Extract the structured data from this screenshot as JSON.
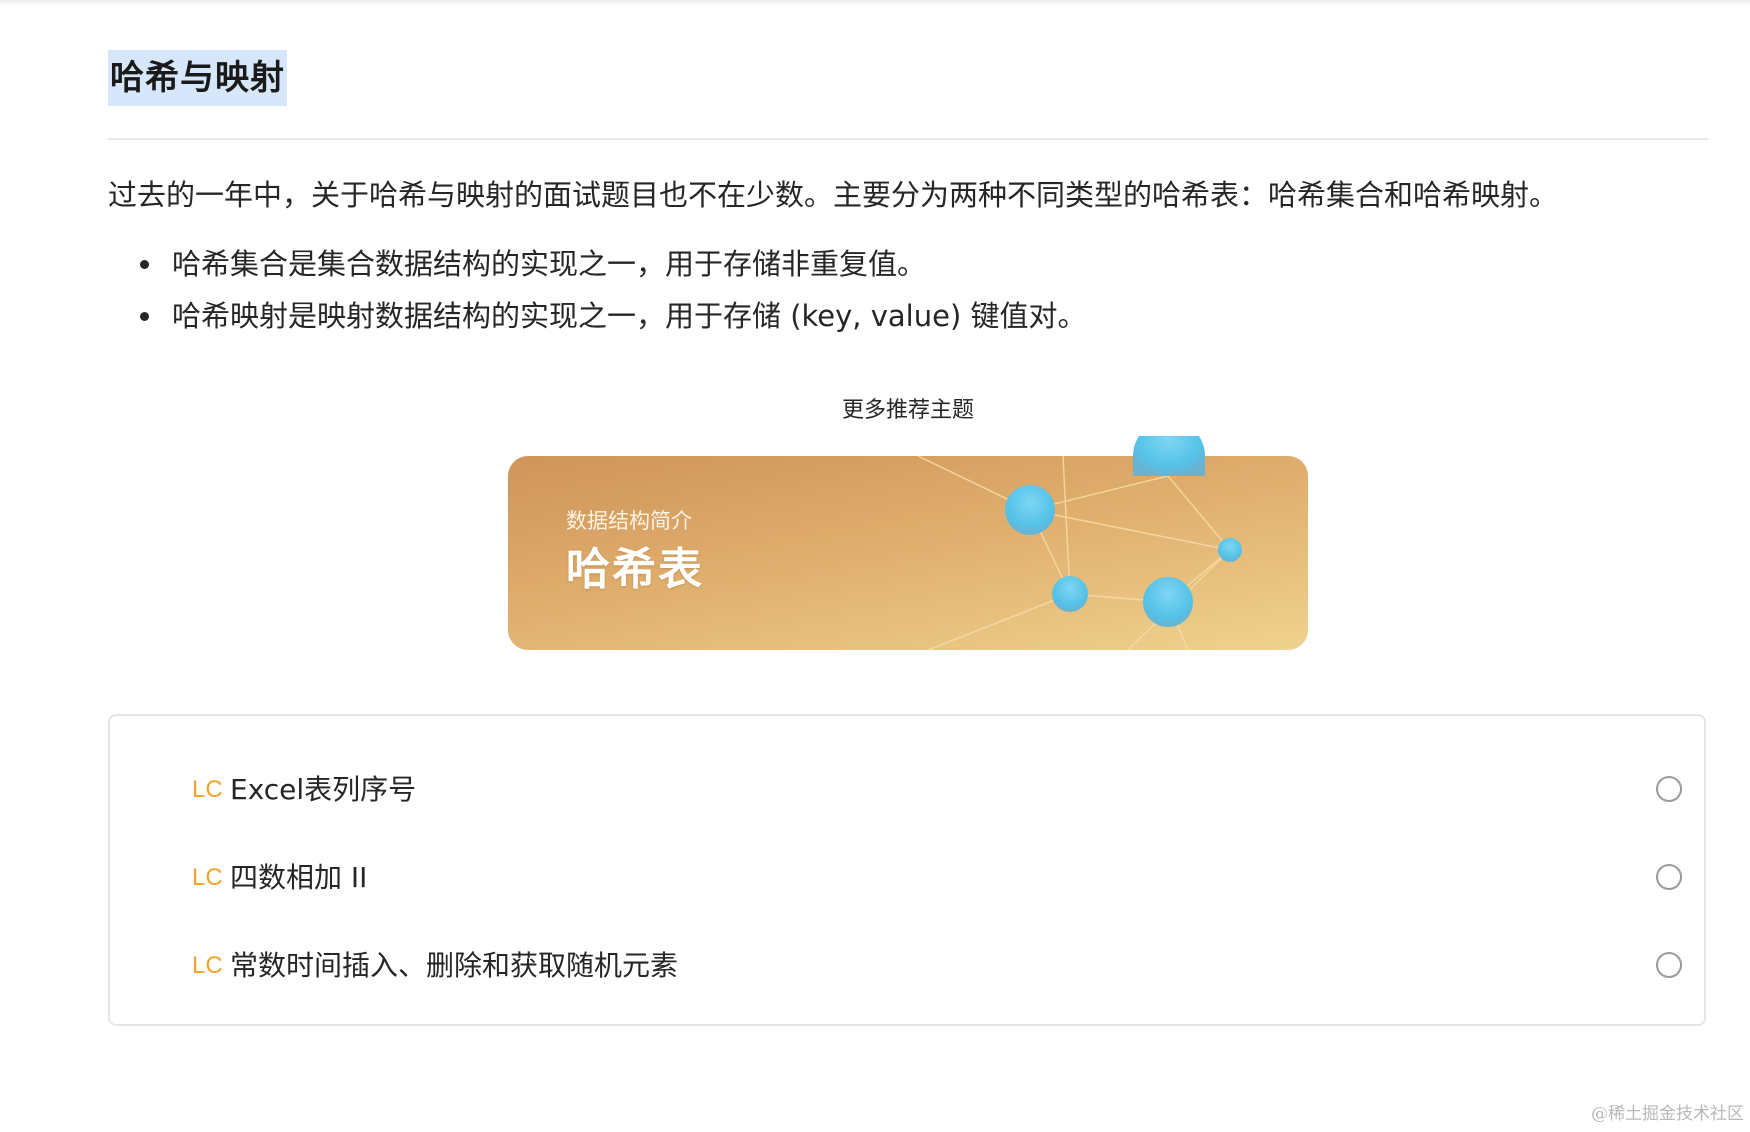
{
  "heading": "哈希与映射",
  "intro": "过去的一年中，关于哈希与映射的面试题目也不在少数。主要分为两种不同类型的哈希表：哈希集合和哈希映射。",
  "bullets": [
    "哈希集合是集合数据结构的实现之一，用于存储非重复值。",
    "哈希映射是映射数据结构的实现之一，用于存储 (key, value) 键值对。"
  ],
  "more_topics_label": "更多推荐主题",
  "banner": {
    "subtitle": "数据结构简介",
    "title": "哈希表",
    "gradient_colors": [
      "#cf945a",
      "#efd28e"
    ],
    "ball_color": "#5cc7ea"
  },
  "problems": [
    {
      "prefix": "LC",
      "title": "Excel表列序号",
      "completed": false
    },
    {
      "prefix": "LC",
      "title": "四数相加 II",
      "completed": false
    },
    {
      "prefix": "LC",
      "title": "常数时间插入、删除和获取随机元素",
      "completed": false
    }
  ],
  "watermark": "@稀土掘金技术社区",
  "colors": {
    "accent_lc": "#f0a42f",
    "heading_highlight": "#d7e7fb"
  }
}
